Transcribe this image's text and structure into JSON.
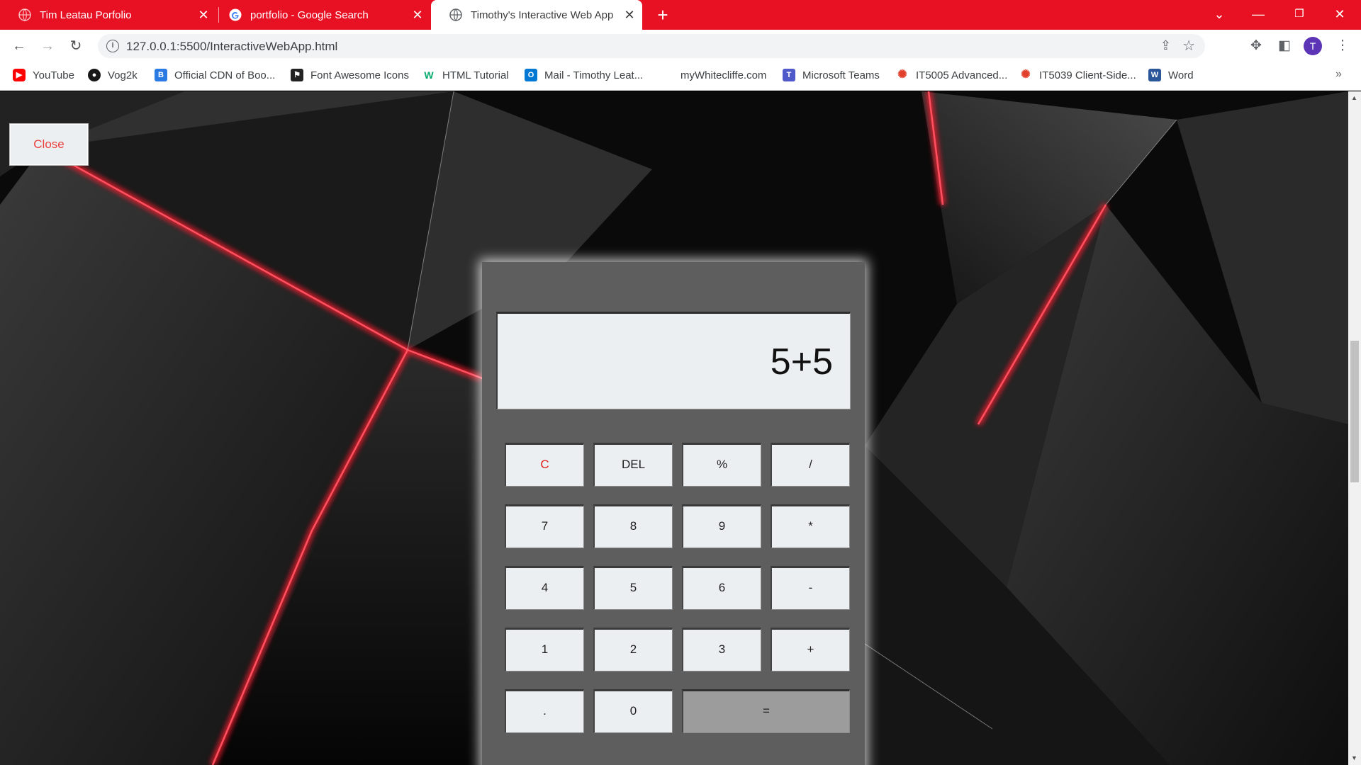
{
  "browser": {
    "tabs": [
      {
        "title": "Tim Leatau Porfolio",
        "favicon": "globe-icon",
        "active": false
      },
      {
        "title": "portfolio - Google Search",
        "favicon": "google-icon",
        "active": false
      },
      {
        "title": "Timothy's Interactive Web App",
        "favicon": "globe-icon",
        "active": true
      }
    ],
    "url": "127.0.0.1:5500/InteractiveWebApp.html",
    "profile_initial": "T",
    "bookmarks": [
      {
        "label": "YouTube",
        "icon": "youtube-icon",
        "color": "#ff0000"
      },
      {
        "label": "Vog2k",
        "icon": "github-icon",
        "color": "#181717"
      },
      {
        "label": "Official CDN of Boo...",
        "icon": "bootstrap-icon",
        "color": "#2a7ae4"
      },
      {
        "label": "Font Awesome Icons",
        "icon": "fontawesome-icon",
        "color": "#222222"
      },
      {
        "label": "HTML Tutorial",
        "icon": "w3schools-icon",
        "color": "#04aa6d"
      },
      {
        "label": "Mail - Timothy Leat...",
        "icon": "outlook-icon",
        "color": "#0078d4"
      },
      {
        "label": "myWhitecliffe.com",
        "icon": "none",
        "color": "#ffffff"
      },
      {
        "label": "Microsoft Teams",
        "icon": "teams-icon",
        "color": "#5059c9"
      },
      {
        "label": "IT5005 Advanced...",
        "icon": "canvas-icon",
        "color": "#e13f2b"
      },
      {
        "label": "IT5039 Client-Side...",
        "icon": "canvas-icon",
        "color": "#e13f2b"
      },
      {
        "label": "Word",
        "icon": "word-icon",
        "color": "#2b579a"
      }
    ],
    "theme_color": "#e81123"
  },
  "page": {
    "close_label": "Close",
    "calculator": {
      "display": "5+5",
      "keys": [
        "C",
        "DEL",
        "%",
        "/",
        "7",
        "8",
        "9",
        "*",
        "4",
        "5",
        "6",
        "-",
        "1",
        "2",
        "3",
        "+",
        ".",
        "0",
        "="
      ]
    }
  }
}
